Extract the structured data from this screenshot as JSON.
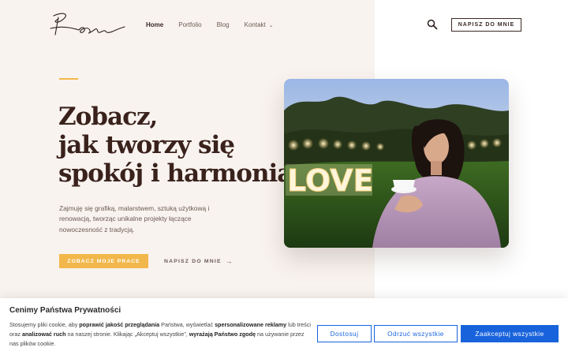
{
  "header": {
    "nav": [
      {
        "label": "Home",
        "active": true
      },
      {
        "label": "Portfolio"
      },
      {
        "label": "Blog"
      },
      {
        "label": "Kontakt",
        "has_dropdown": true
      }
    ],
    "cta_label": "NAPISZ DO MNIE"
  },
  "hero": {
    "headline_lines": [
      "Zobacz,",
      "jak tworzy się",
      "spokój i harmonia"
    ],
    "description": "Zajmuję się grafiką, malarstwem, sztuką użytkową i renowacją, tworząc unikalne projekty łączące nowoczesność z tradycją.",
    "primary_button": "ZOBACZ MOJE PRACE",
    "secondary_link": "NAPISZ DO MNIE",
    "photo_sign_text": "LOVE"
  },
  "cookie": {
    "title": "Cenimy Państwa Prywatności",
    "text_parts": [
      {
        "t": "Stosujemy pliki cookie, aby "
      },
      {
        "t": "poprawić jakość przeglądania",
        "b": true
      },
      {
        "t": " Państwa, wyświetlać "
      },
      {
        "t": "spersonalizowane reklamy",
        "b": true
      },
      {
        "t": " lub treści oraz "
      },
      {
        "t": "analizować ruch",
        "b": true
      },
      {
        "t": " na naszej stronie. Klikając „Akceptuj wszystkie”, "
      },
      {
        "t": "wyrażają Państwo zgodę",
        "b": true
      },
      {
        "t": " na używanie przez nas plików cookie."
      }
    ],
    "buttons": {
      "customize": "Dostosuj",
      "reject": "Odrzuć wszystkie",
      "accept": "Zaakceptuj wszystkie"
    }
  },
  "colors": {
    "accent": "#f2b74a",
    "hero_bg": "#f9f3ef",
    "heading": "#3a221c",
    "cookie_blue": "#1863dc"
  },
  "icons": {
    "search": "search-icon",
    "arrow": "arrow-right-icon",
    "chevron": "chevron-down-icon"
  }
}
